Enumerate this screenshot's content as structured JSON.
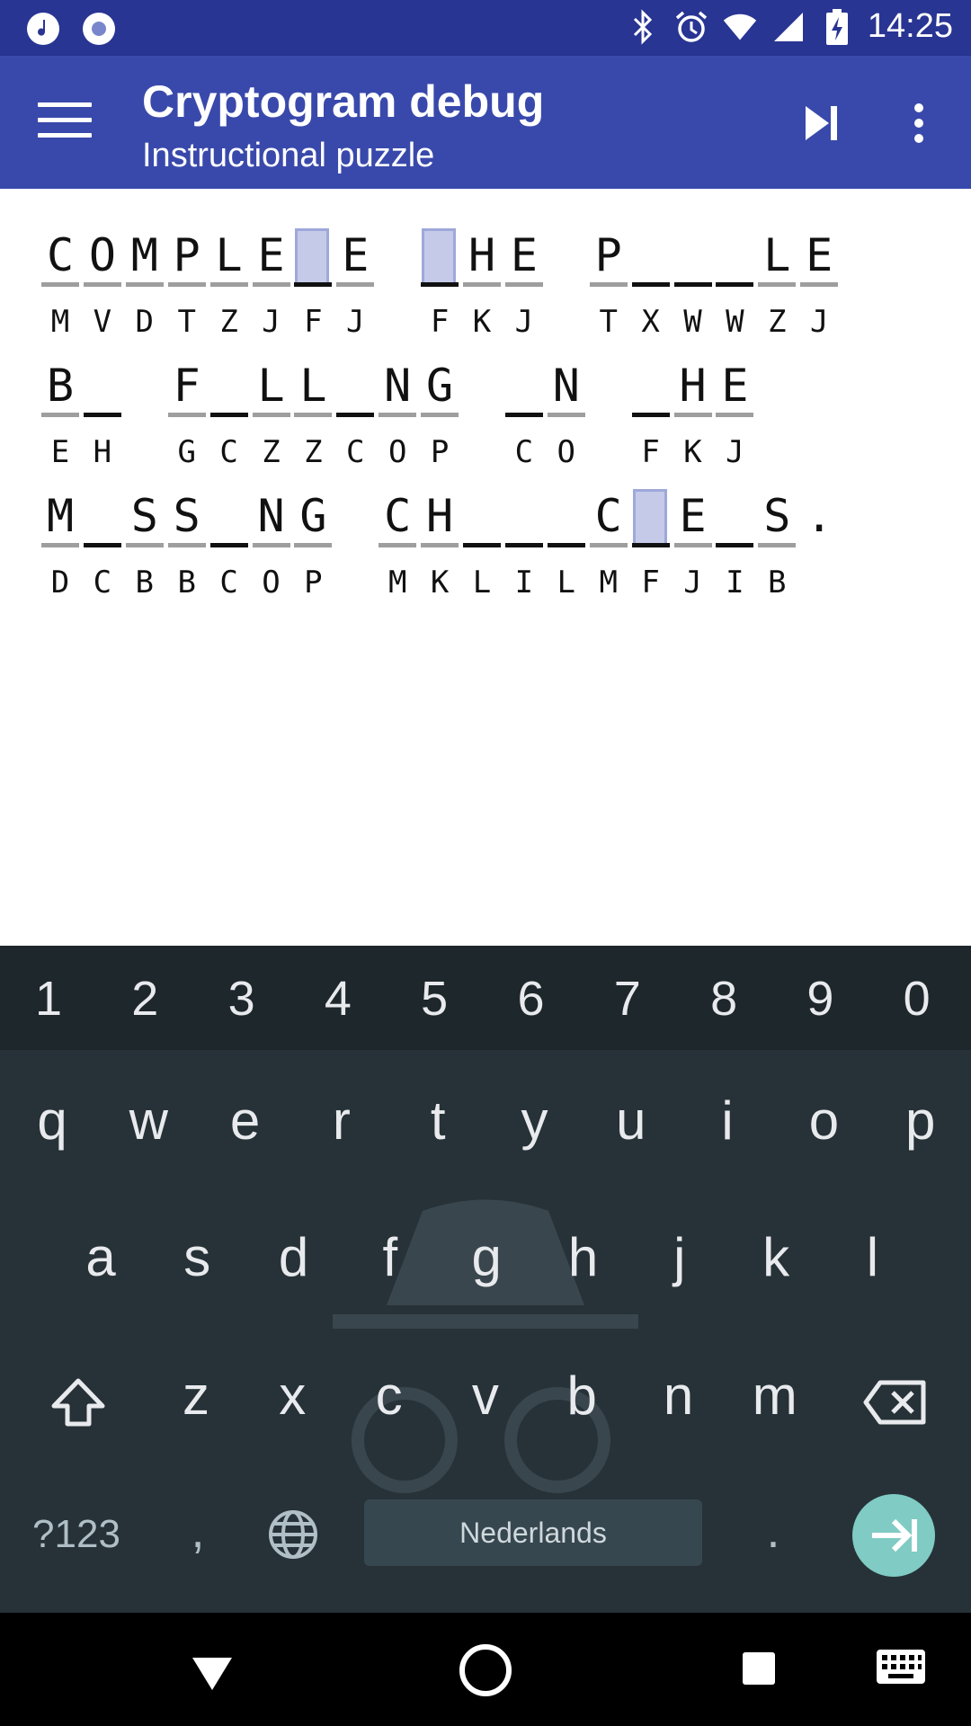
{
  "status_bar": {
    "time": "14:25",
    "icons": [
      "music-note-icon",
      "record-icon",
      "bluetooth-icon",
      "alarm-icon",
      "wifi-icon",
      "signal-icon",
      "battery-charging-icon"
    ]
  },
  "app_bar": {
    "title": "Cryptogram debug",
    "subtitle": "Instructional puzzle",
    "menu_icon": "hamburger-menu-icon",
    "actions": [
      "skip-next-icon",
      "overflow-menu-icon"
    ]
  },
  "puzzle": {
    "rows": [
      {
        "cells": [
          {
            "a": "C",
            "e": "M"
          },
          {
            "a": "O",
            "e": "V"
          },
          {
            "a": "M",
            "e": "D"
          },
          {
            "a": "P",
            "e": "T"
          },
          {
            "a": "L",
            "e": "Z"
          },
          {
            "a": "E",
            "e": "J"
          },
          {
            "a": "",
            "e": "F",
            "sel": true
          },
          {
            "a": "E",
            "e": "J"
          },
          {
            "space": true
          },
          {
            "a": "",
            "e": "F",
            "sel": true
          },
          {
            "a": "H",
            "e": "K"
          },
          {
            "a": "E",
            "e": "J"
          },
          {
            "space": true
          },
          {
            "a": "P",
            "e": "T"
          },
          {
            "a": "",
            "e": "X"
          },
          {
            "a": "",
            "e": "W"
          },
          {
            "a": "",
            "e": "W"
          },
          {
            "a": "L",
            "e": "Z"
          },
          {
            "a": "E",
            "e": "J"
          }
        ]
      },
      {
        "cells": [
          {
            "a": "B",
            "e": "E"
          },
          {
            "a": "",
            "e": "H"
          },
          {
            "space": true
          },
          {
            "a": "F",
            "e": "G"
          },
          {
            "a": "",
            "e": "C"
          },
          {
            "a": "L",
            "e": "Z"
          },
          {
            "a": "L",
            "e": "Z"
          },
          {
            "a": "",
            "e": "C"
          },
          {
            "a": "N",
            "e": "O"
          },
          {
            "a": "G",
            "e": "P"
          },
          {
            "space": true
          },
          {
            "a": "",
            "e": "C"
          },
          {
            "a": "N",
            "e": "O"
          },
          {
            "space": true
          },
          {
            "a": "",
            "e": "F"
          },
          {
            "a": "H",
            "e": "K"
          },
          {
            "a": "E",
            "e": "J"
          }
        ]
      },
      {
        "cells": [
          {
            "a": "M",
            "e": "D"
          },
          {
            "a": "",
            "e": "C"
          },
          {
            "a": "S",
            "e": "B"
          },
          {
            "a": "S",
            "e": "B"
          },
          {
            "a": "",
            "e": "C"
          },
          {
            "a": "N",
            "e": "O"
          },
          {
            "a": "G",
            "e": "P"
          },
          {
            "space": true
          },
          {
            "a": "C",
            "e": "M"
          },
          {
            "a": "H",
            "e": "K"
          },
          {
            "a": "",
            "e": "L"
          },
          {
            "a": "",
            "e": "I"
          },
          {
            "a": "",
            "e": "L"
          },
          {
            "a": "C",
            "e": "M"
          },
          {
            "a": "",
            "e": "F",
            "sel": true
          },
          {
            "a": "E",
            "e": "J"
          },
          {
            "a": "",
            "e": "I"
          },
          {
            "a": "S",
            "e": "B"
          },
          {
            "punct": "."
          }
        ]
      }
    ]
  },
  "keyboard": {
    "number_row": [
      "1",
      "2",
      "3",
      "4",
      "5",
      "6",
      "7",
      "8",
      "9",
      "0"
    ],
    "row1": [
      "q",
      "w",
      "e",
      "r",
      "t",
      "y",
      "u",
      "i",
      "o",
      "p"
    ],
    "row2": [
      "a",
      "s",
      "d",
      "f",
      "g",
      "h",
      "j",
      "k",
      "l"
    ],
    "row3": [
      "z",
      "x",
      "c",
      "v",
      "b",
      "n",
      "m"
    ],
    "symbols_label": "?123",
    "comma_label": ",",
    "period_label": ".",
    "space_label": "Nederlands",
    "incognito_icon": "incognito-icon"
  },
  "nav_bar": {
    "buttons": [
      "back-icon",
      "home-icon",
      "recents-icon",
      "keyboard-switch-icon"
    ]
  },
  "colors": {
    "app_bar": "#3949ab",
    "status_bar": "#283593",
    "keyboard_bg": "#263238",
    "enter": "#80cbc4",
    "selection": "#c5cae9"
  }
}
